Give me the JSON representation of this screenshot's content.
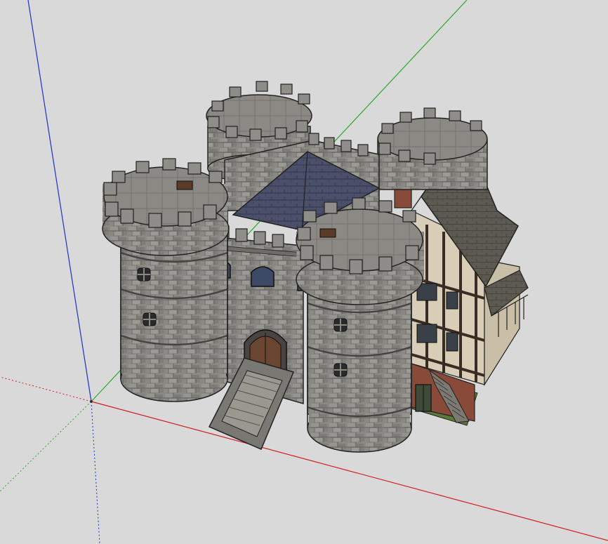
{
  "viewport": {
    "background": "#d9d9d9",
    "axis_colors": {
      "red": "#d02020",
      "green": "#2aa82a",
      "blue": "#2030c8"
    }
  },
  "model": {
    "palette": {
      "stone": "#8a8883",
      "stone_dark": "#6e6c67",
      "stone_light": "#a6a49e",
      "roof_slate": "#4a4f6a",
      "roof_shingle": "#5d5a52",
      "timber": "#3a2c22",
      "plaster": "#d8cdb6",
      "door_wood": "#6a4630",
      "brick": "#8a4a3a",
      "grass": "#5a7a3a"
    },
    "icons": [
      "axis-origin-icon"
    ]
  }
}
